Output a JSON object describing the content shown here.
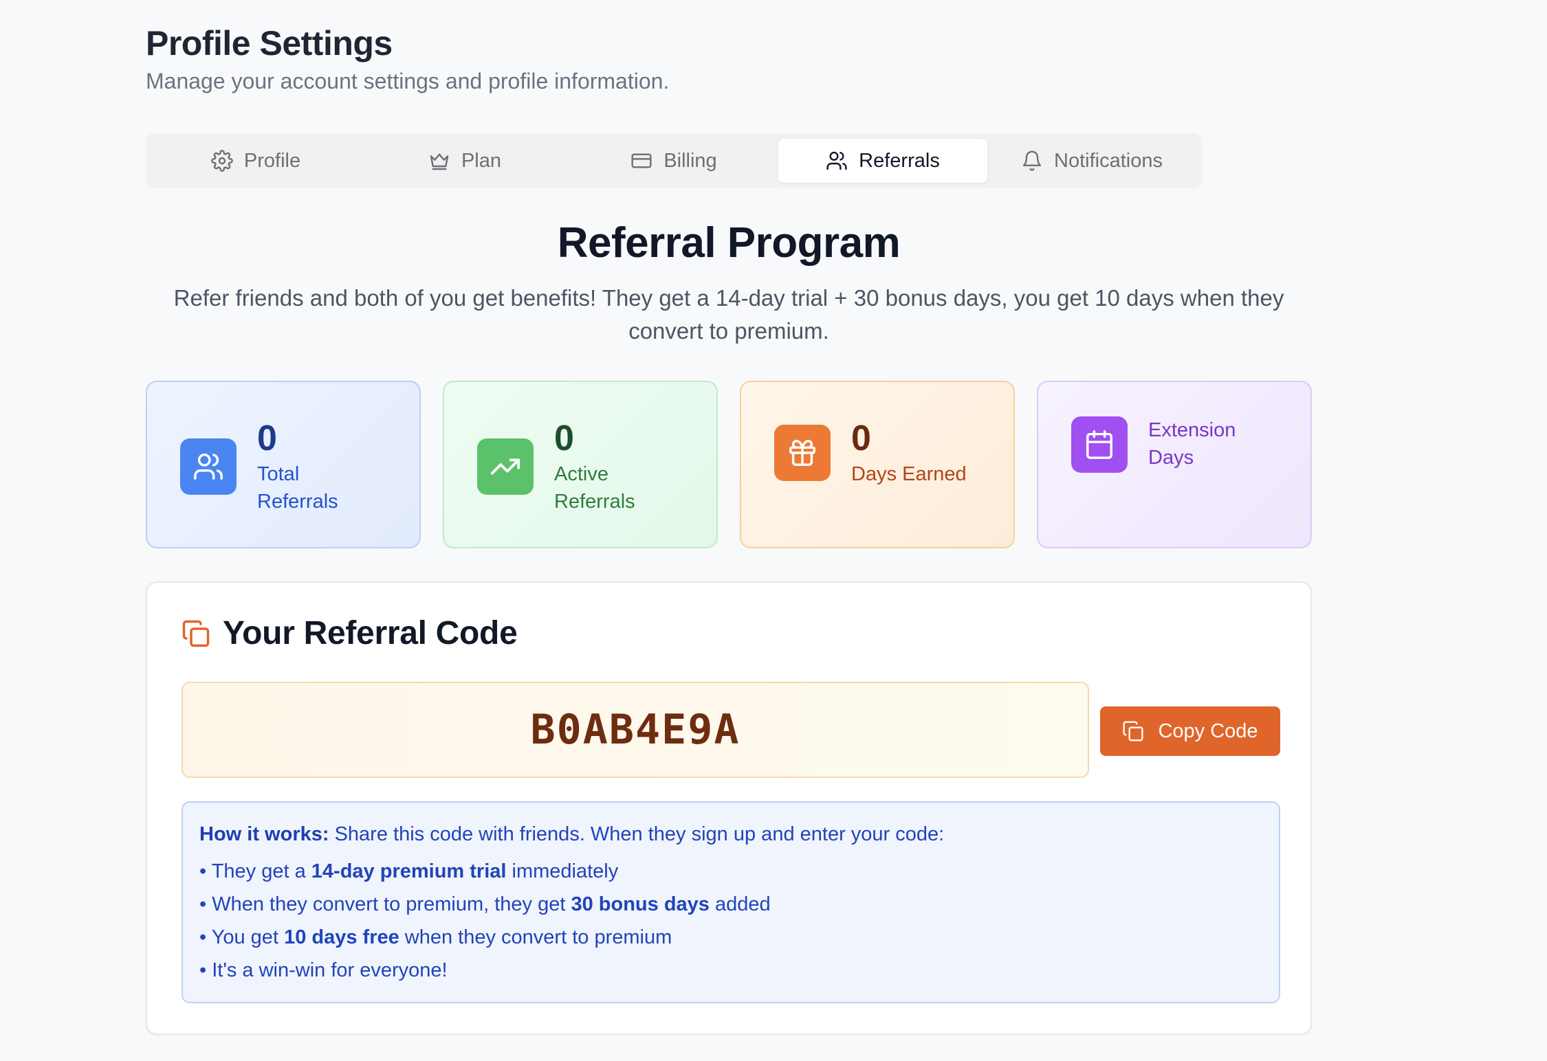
{
  "header": {
    "title": "Profile Settings",
    "subtitle": "Manage your account settings and profile information."
  },
  "tabs": [
    {
      "label": "Profile",
      "icon": "gear-icon",
      "active": false
    },
    {
      "label": "Plan",
      "icon": "crown-icon",
      "active": false
    },
    {
      "label": "Billing",
      "icon": "credit-card-icon",
      "active": false
    },
    {
      "label": "Referrals",
      "icon": "users-icon",
      "active": true
    },
    {
      "label": "Notifications",
      "icon": "bell-icon",
      "active": false
    }
  ],
  "referral": {
    "title": "Referral Program",
    "description": "Refer friends and both of you get benefits! They get a 14-day trial + 30 bonus days, you get 10 days when they convert to premium."
  },
  "stats": {
    "total": {
      "value": "0",
      "label": "Total Referrals",
      "icon": "users-icon",
      "color": "#4b85f1"
    },
    "active": {
      "value": "0",
      "label": "Active Referrals",
      "icon": "trending-up-icon",
      "color": "#5cc16b"
    },
    "days": {
      "value": "0",
      "label": "Days Earned",
      "icon": "gift-icon",
      "color": "#ec7a34"
    },
    "extension": {
      "label": "Extension Days",
      "icon": "calendar-icon",
      "color": "#a04ff0"
    }
  },
  "code_panel": {
    "title": "Your Referral Code",
    "icon": "copy-icon",
    "code": "B0AB4E9A",
    "copy_label": "Copy Code",
    "accent": "#e0652a"
  },
  "how_it_works": {
    "intro_bold": "How it works:",
    "intro_text": " Share this code with friends. When they sign up and enter your code:",
    "items": [
      {
        "pre": "They get a ",
        "bold": "14-day premium trial",
        "post": " immediately"
      },
      {
        "pre": "When they convert to premium, they get ",
        "bold": "30 bonus days",
        "post": " added"
      },
      {
        "pre": "You get ",
        "bold": "10 days free",
        "post": " when they convert to premium"
      },
      {
        "pre": "It's a win-win for everyone!",
        "bold": "",
        "post": ""
      }
    ]
  }
}
